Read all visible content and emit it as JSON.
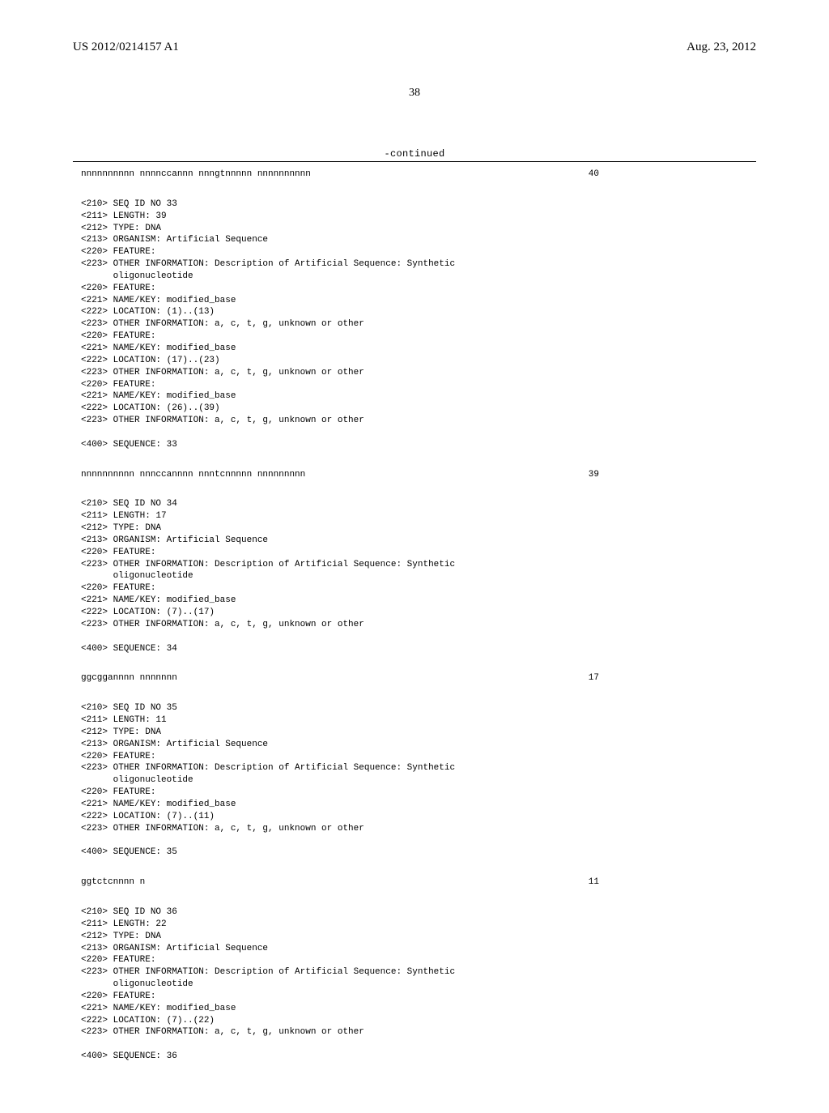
{
  "header": {
    "pub_number": "US 2012/0214157 A1",
    "pub_date": "Aug. 23, 2012"
  },
  "page_number": "38",
  "continued_label": "-continued",
  "top_sequence": {
    "seq": "nnnnnnnnnn nnnnccannn nnngtnnnnn nnnnnnnnnn",
    "len": "40"
  },
  "entries": [
    {
      "lines": [
        "<210> SEQ ID NO 33",
        "<211> LENGTH: 39",
        "<212> TYPE: DNA",
        "<213> ORGANISM: Artificial Sequence",
        "<220> FEATURE:",
        "<223> OTHER INFORMATION: Description of Artificial Sequence: Synthetic",
        "      oligonucleotide",
        "<220> FEATURE:",
        "<221> NAME/KEY: modified_base",
        "<222> LOCATION: (1)..(13)",
        "<223> OTHER INFORMATION: a, c, t, g, unknown or other",
        "<220> FEATURE:",
        "<221> NAME/KEY: modified_base",
        "<222> LOCATION: (17)..(23)",
        "<223> OTHER INFORMATION: a, c, t, g, unknown or other",
        "<220> FEATURE:",
        "<221> NAME/KEY: modified_base",
        "<222> LOCATION: (26)..(39)",
        "<223> OTHER INFORMATION: a, c, t, g, unknown or other",
        "",
        "<400> SEQUENCE: 33"
      ],
      "seq": "nnnnnnnnnn nnnccannnn nnntcnnnnn nnnnnnnnn",
      "len": "39"
    },
    {
      "lines": [
        "<210> SEQ ID NO 34",
        "<211> LENGTH: 17",
        "<212> TYPE: DNA",
        "<213> ORGANISM: Artificial Sequence",
        "<220> FEATURE:",
        "<223> OTHER INFORMATION: Description of Artificial Sequence: Synthetic",
        "      oligonucleotide",
        "<220> FEATURE:",
        "<221> NAME/KEY: modified_base",
        "<222> LOCATION: (7)..(17)",
        "<223> OTHER INFORMATION: a, c, t, g, unknown or other",
        "",
        "<400> SEQUENCE: 34"
      ],
      "seq": "ggcggannnn nnnnnnn",
      "len": "17"
    },
    {
      "lines": [
        "<210> SEQ ID NO 35",
        "<211> LENGTH: 11",
        "<212> TYPE: DNA",
        "<213> ORGANISM: Artificial Sequence",
        "<220> FEATURE:",
        "<223> OTHER INFORMATION: Description of Artificial Sequence: Synthetic",
        "      oligonucleotide",
        "<220> FEATURE:",
        "<221> NAME/KEY: modified_base",
        "<222> LOCATION: (7)..(11)",
        "<223> OTHER INFORMATION: a, c, t, g, unknown or other",
        "",
        "<400> SEQUENCE: 35"
      ],
      "seq": "ggtctcnnnn n",
      "len": "11"
    },
    {
      "lines": [
        "<210> SEQ ID NO 36",
        "<211> LENGTH: 22",
        "<212> TYPE: DNA",
        "<213> ORGANISM: Artificial Sequence",
        "<220> FEATURE:",
        "<223> OTHER INFORMATION: Description of Artificial Sequence: Synthetic",
        "      oligonucleotide",
        "<220> FEATURE:",
        "<221> NAME/KEY: modified_base",
        "<222> LOCATION: (7)..(22)",
        "<223> OTHER INFORMATION: a, c, t, g, unknown or other",
        "",
        "<400> SEQUENCE: 36"
      ],
      "seq": "",
      "len": ""
    }
  ]
}
